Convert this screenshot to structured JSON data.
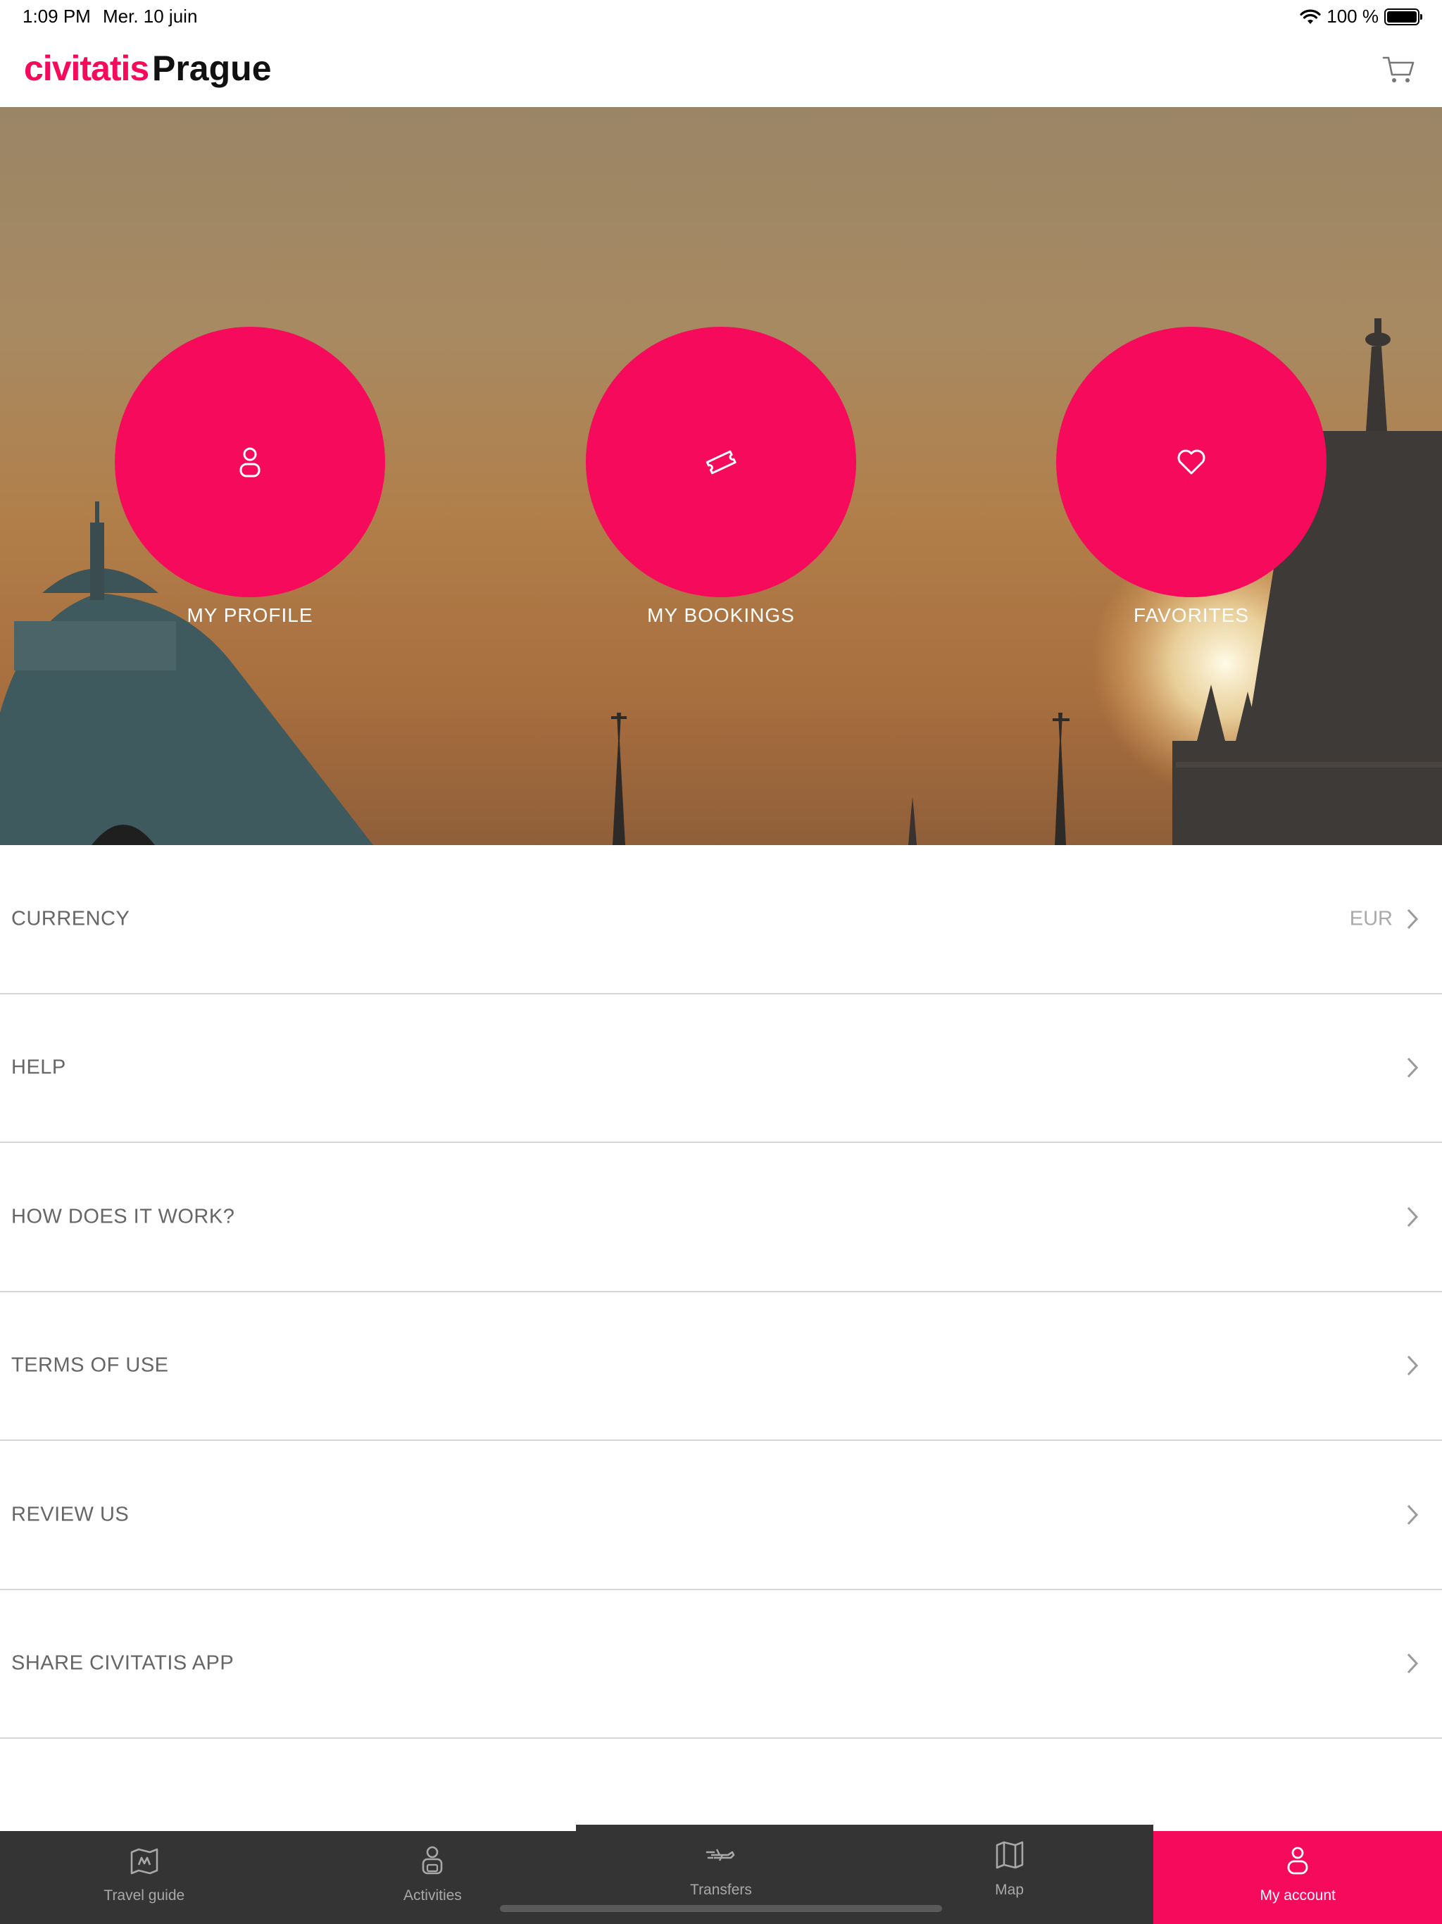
{
  "status_bar": {
    "time": "1:09 PM",
    "date": "Mer. 10 juin",
    "battery": "100 %"
  },
  "header": {
    "logo": "civitatis",
    "city": "Prague",
    "cart_icon": "cart-icon"
  },
  "hero": {
    "buttons": [
      {
        "label": "MY PROFILE",
        "icon": "user-icon"
      },
      {
        "label": "MY BOOKINGS",
        "icon": "ticket-icon"
      },
      {
        "label": "FAVORITES",
        "icon": "heart-icon"
      }
    ]
  },
  "menu": {
    "items": [
      {
        "label": "CURRENCY",
        "value": "EUR"
      },
      {
        "label": "HELP",
        "value": ""
      },
      {
        "label": "HOW DOES IT WORK?",
        "value": ""
      },
      {
        "label": "TERMS OF USE",
        "value": ""
      },
      {
        "label": "REVIEW US",
        "value": ""
      },
      {
        "label": "SHARE CIVITATIS APP",
        "value": ""
      }
    ]
  },
  "tab_bar": {
    "tabs": [
      {
        "label": "Travel guide",
        "icon": "map-guide-icon"
      },
      {
        "label": "Activities",
        "icon": "activities-icon"
      },
      {
        "label": "Transfers",
        "icon": "transfer-icon"
      },
      {
        "label": "Map",
        "icon": "map-icon"
      },
      {
        "label": "My account",
        "icon": "account-icon"
      }
    ],
    "active": "My account"
  },
  "colors": {
    "brand": "#f50a5c",
    "tab_bar": "#343434"
  }
}
